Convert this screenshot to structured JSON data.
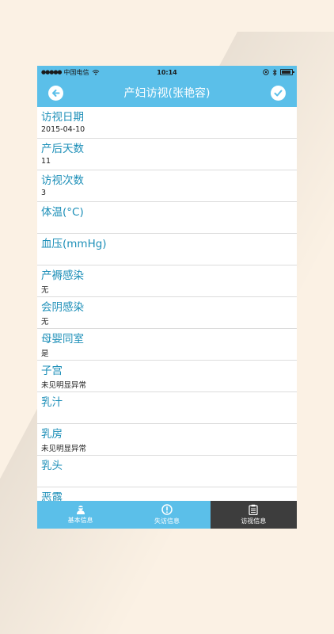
{
  "status": {
    "signal": "●●●●●",
    "carrier": "中国电信",
    "time": "10:14"
  },
  "nav": {
    "title": "产妇访视(张艳容)",
    "back_icon": "back-arrow-icon",
    "done_icon": "check-icon"
  },
  "fields": [
    {
      "label": "访视日期",
      "value": "2015-04-10"
    },
    {
      "label": "产后天数",
      "value": "11"
    },
    {
      "label": "访视次数",
      "value": "3"
    },
    {
      "label": "体温(°C)",
      "value": ""
    },
    {
      "label": "血压(mmHg)",
      "value": ""
    },
    {
      "label": "产褥感染",
      "value": "无"
    },
    {
      "label": "会阴感染",
      "value": "无"
    },
    {
      "label": "母婴同室",
      "value": "是"
    },
    {
      "label": "子宫",
      "value": "未见明显异常"
    },
    {
      "label": "乳汁",
      "value": ""
    },
    {
      "label": "乳房",
      "value": "未见明显异常"
    },
    {
      "label": "乳头",
      "value": ""
    },
    {
      "label": "恶露",
      "value": ""
    }
  ],
  "tabs": [
    {
      "label": "基本信息",
      "icon": "user-icon",
      "active": false
    },
    {
      "label": "失访信息",
      "icon": "alert-icon",
      "active": false
    },
    {
      "label": "访视信息",
      "icon": "clipboard-icon",
      "active": true
    }
  ],
  "colors": {
    "accent": "#5bbfe9",
    "label": "#1d8fb8",
    "active_tab": "#3d3d3d"
  }
}
